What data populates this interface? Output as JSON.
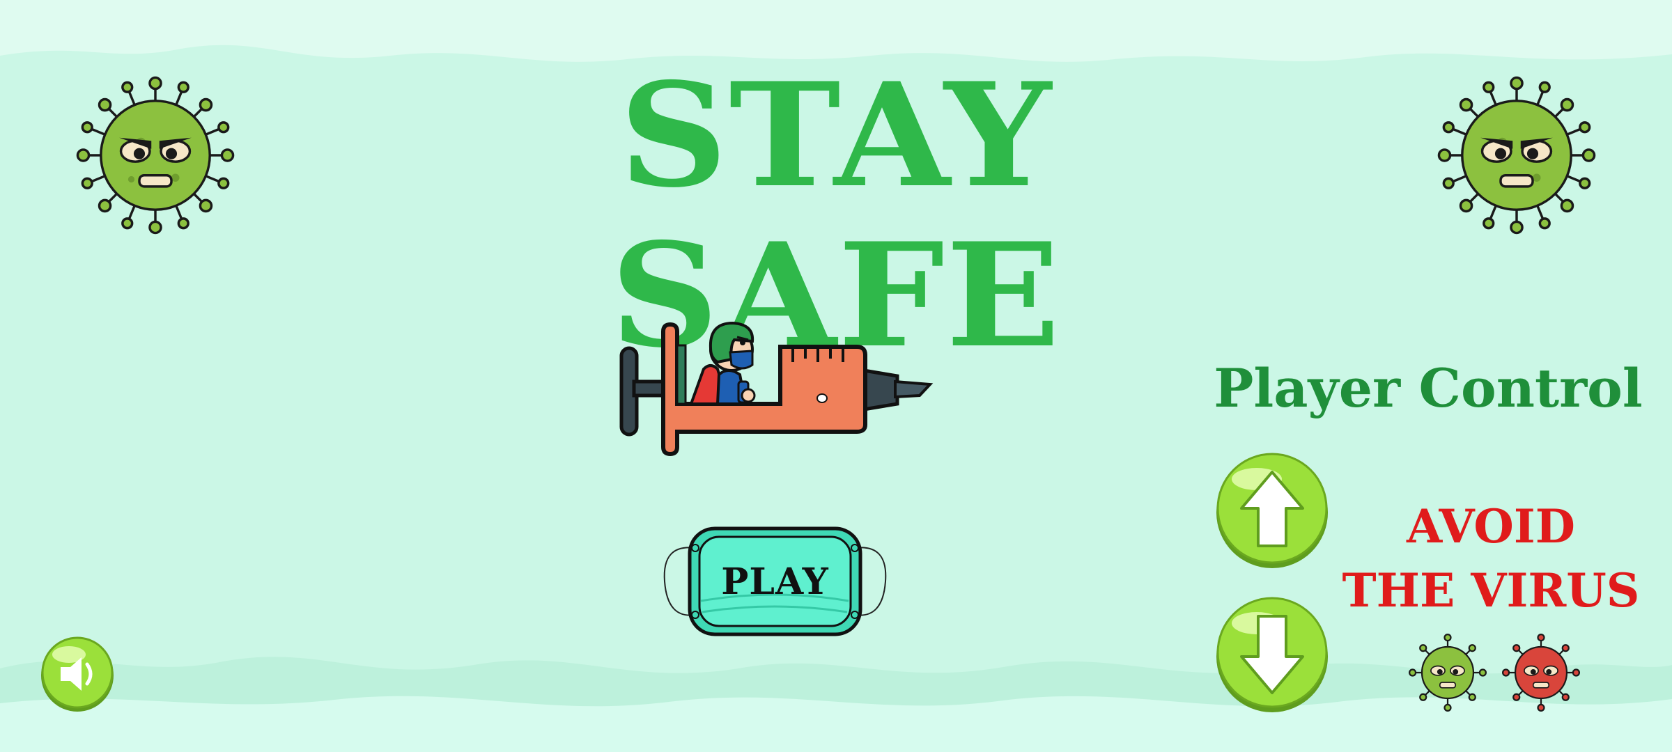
{
  "title": "STAY SAFE",
  "play_button": {
    "label": "PLAY"
  },
  "controls": {
    "title": "Player Control",
    "up_icon": "arrow-up-icon",
    "down_icon": "arrow-down-icon"
  },
  "hint": {
    "line1": "AVOID",
    "line2": "THE VIRUS"
  },
  "sound_icon": "speaker-icon",
  "colors": {
    "background": "#dffbf0",
    "title": "#2fb84a",
    "control_title": "#1f8f3a",
    "warning": "#e01b1b",
    "button_green": "#9be03a",
    "play_mask": "#4ee8c4",
    "virus_green": "#8cc13f",
    "virus_red": "#d9453b",
    "syringe": "#f0805a"
  }
}
